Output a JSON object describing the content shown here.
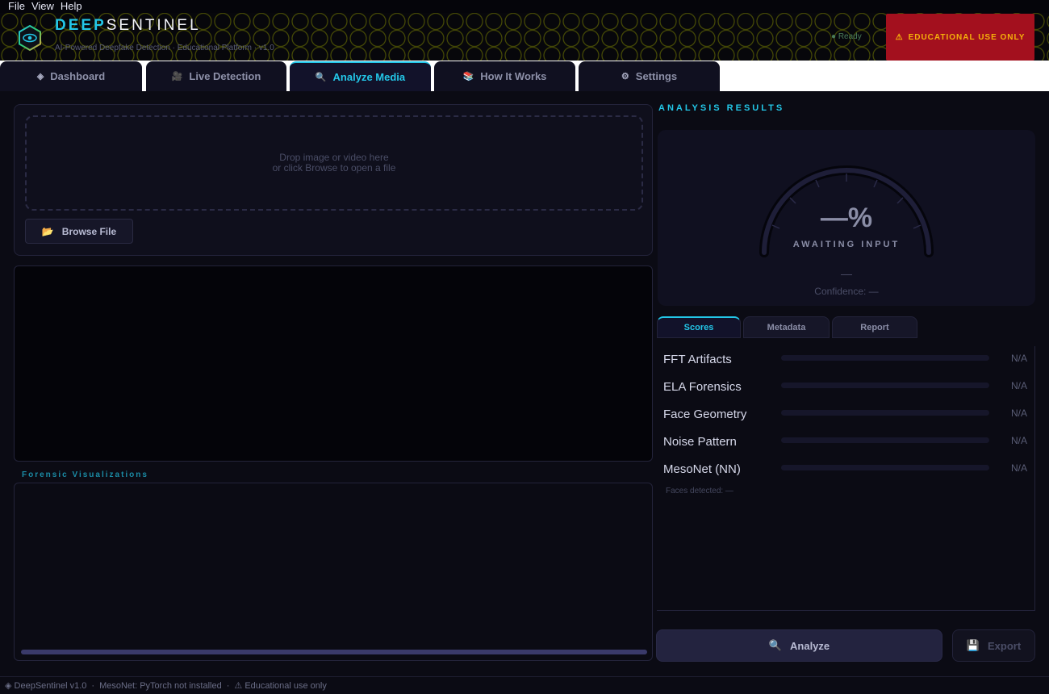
{
  "menu": [
    "File",
    "View",
    "Help"
  ],
  "header": {
    "brand_a": "DEEP",
    "brand_b": "SENTINEL",
    "subtitle": "AI-Powered Deepfake Detection · Educational Platform · v1.0",
    "status": "● Ready",
    "edu_icon": "warning-icon",
    "edu_label": "EDUCATIONAL USE ONLY"
  },
  "tabs": [
    {
      "label": "Dashboard",
      "icon": "◈"
    },
    {
      "label": "Live Detection",
      "icon": "🎥"
    },
    {
      "label": "Analyze Media",
      "icon": "🔍"
    },
    {
      "label": "How It Works",
      "icon": "📚"
    },
    {
      "label": "Settings",
      "icon": "⚙"
    }
  ],
  "dropzone": {
    "line1": "Drop image or video here",
    "line2": "or click Browse to open a file"
  },
  "browse": {
    "icon": "📂",
    "label": "Browse File"
  },
  "visualizations": {
    "title": "Forensic Visualizations"
  },
  "results": {
    "title": "ANALYSIS RESULTS",
    "gauge_value": "—%",
    "gauge_label": "AWAITING INPUT",
    "gauge_dash": "—",
    "confidence": "Confidence: —"
  },
  "subtabs": [
    "Scores",
    "Metadata",
    "Report"
  ],
  "scores": [
    {
      "name": "FFT Artifacts",
      "value": "N/A",
      "fraction": 0
    },
    {
      "name": "ELA Forensics",
      "value": "N/A",
      "fraction": 0
    },
    {
      "name": "Face Geometry",
      "value": "N/A",
      "fraction": 0
    },
    {
      "name": "Noise Pattern",
      "value": "N/A",
      "fraction": 0
    },
    {
      "name": "MesoNet (NN)",
      "value": "N/A",
      "fraction": 0
    }
  ],
  "faces": "Faces detected: —",
  "actions": {
    "analyze_icon": "🔍",
    "analyze": "Analyze",
    "export_icon": "💾",
    "export": "Export"
  },
  "statusbar": {
    "app": "◈ DeepSentinel v1.0",
    "sep": "·",
    "mesonet": "MesoNet: PyTorch not installed",
    "edu": "⚠ Educational use only"
  },
  "colors": {
    "accent": "#23c7e8",
    "warning_bg": "#a3101e",
    "warning_text": "#f5b10a"
  }
}
